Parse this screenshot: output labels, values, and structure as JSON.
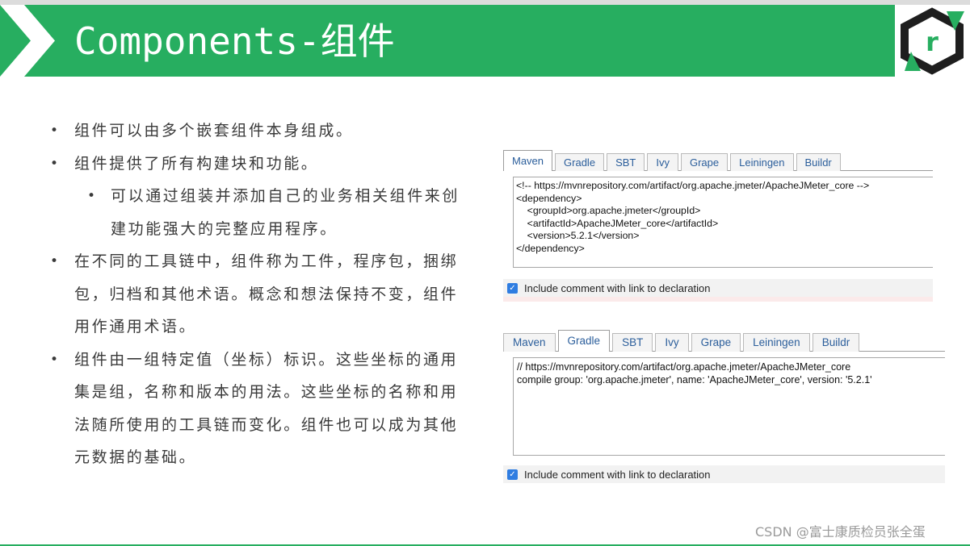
{
  "slide": {
    "title": "Components-组件",
    "logo_letter": "r",
    "colors": {
      "header_green": "#27ae60",
      "logo_dark": "#1e1e1e",
      "tab_text": "#2b5e9b",
      "checkbox_blue": "#2f7de1"
    },
    "icons": {
      "chevron": "chevron-right-icon",
      "logo": "hexagon-r-logo-icon",
      "checkbox": "checkbox-checked-icon"
    }
  },
  "bullets": [
    {
      "level": 1,
      "lines": [
        "组件可以由多个嵌套组件本身组成。"
      ]
    },
    {
      "level": 1,
      "lines": [
        "组件提供了所有构建块和功能。"
      ]
    },
    {
      "level": 2,
      "lines": [
        "可以通过组装并添加自己的业务相关组件来创",
        "建功能强大的完整应用程序。"
      ]
    },
    {
      "level": 1,
      "lines": [
        "在不同的工具链中，组件称为工件，程序包，捆绑",
        "包，归档和其他术语。概念和想法保持不变，组件",
        "用作通用术语。"
      ]
    },
    {
      "level": 1,
      "lines": [
        "组件由一组特定值（坐标）标识。这些坐标的通用",
        "集是组，名称和版本的用法。这些坐标的名称和用",
        "法随所使用的工具链而变化。组件也可以成为其他",
        "元数据的基础。"
      ]
    }
  ],
  "panel_1": {
    "tabs": [
      "Maven",
      "Gradle",
      "SBT",
      "Ivy",
      "Grape",
      "Leiningen",
      "Buildr"
    ],
    "active_tab": "Maven",
    "code_lines": [
      "<!-- https://mvnrepository.com/artifact/org.apache.jmeter/ApacheJMeter_core -->",
      "<dependency>",
      "    <groupId>org.apache.jmeter</groupId>",
      "    <artifactId>ApacheJMeter_core</artifactId>",
      "    <version>5.2.1</version>",
      "</dependency>"
    ],
    "include_label": "Include comment with link to declaration",
    "include_checked": true
  },
  "panel_2": {
    "tabs": [
      "Maven",
      "Gradle",
      "SBT",
      "Ivy",
      "Grape",
      "Leiningen",
      "Buildr"
    ],
    "active_tab": "Gradle",
    "code_lines": [
      "// https://mvnrepository.com/artifact/org.apache.jmeter/ApacheJMeter_core",
      "compile group: 'org.apache.jmeter', name: 'ApacheJMeter_core', version: '5.2.1'"
    ],
    "include_label": "Include comment with link to declaration",
    "include_checked": true
  },
  "watermark": "CSDN @富士康质检员张全蛋"
}
